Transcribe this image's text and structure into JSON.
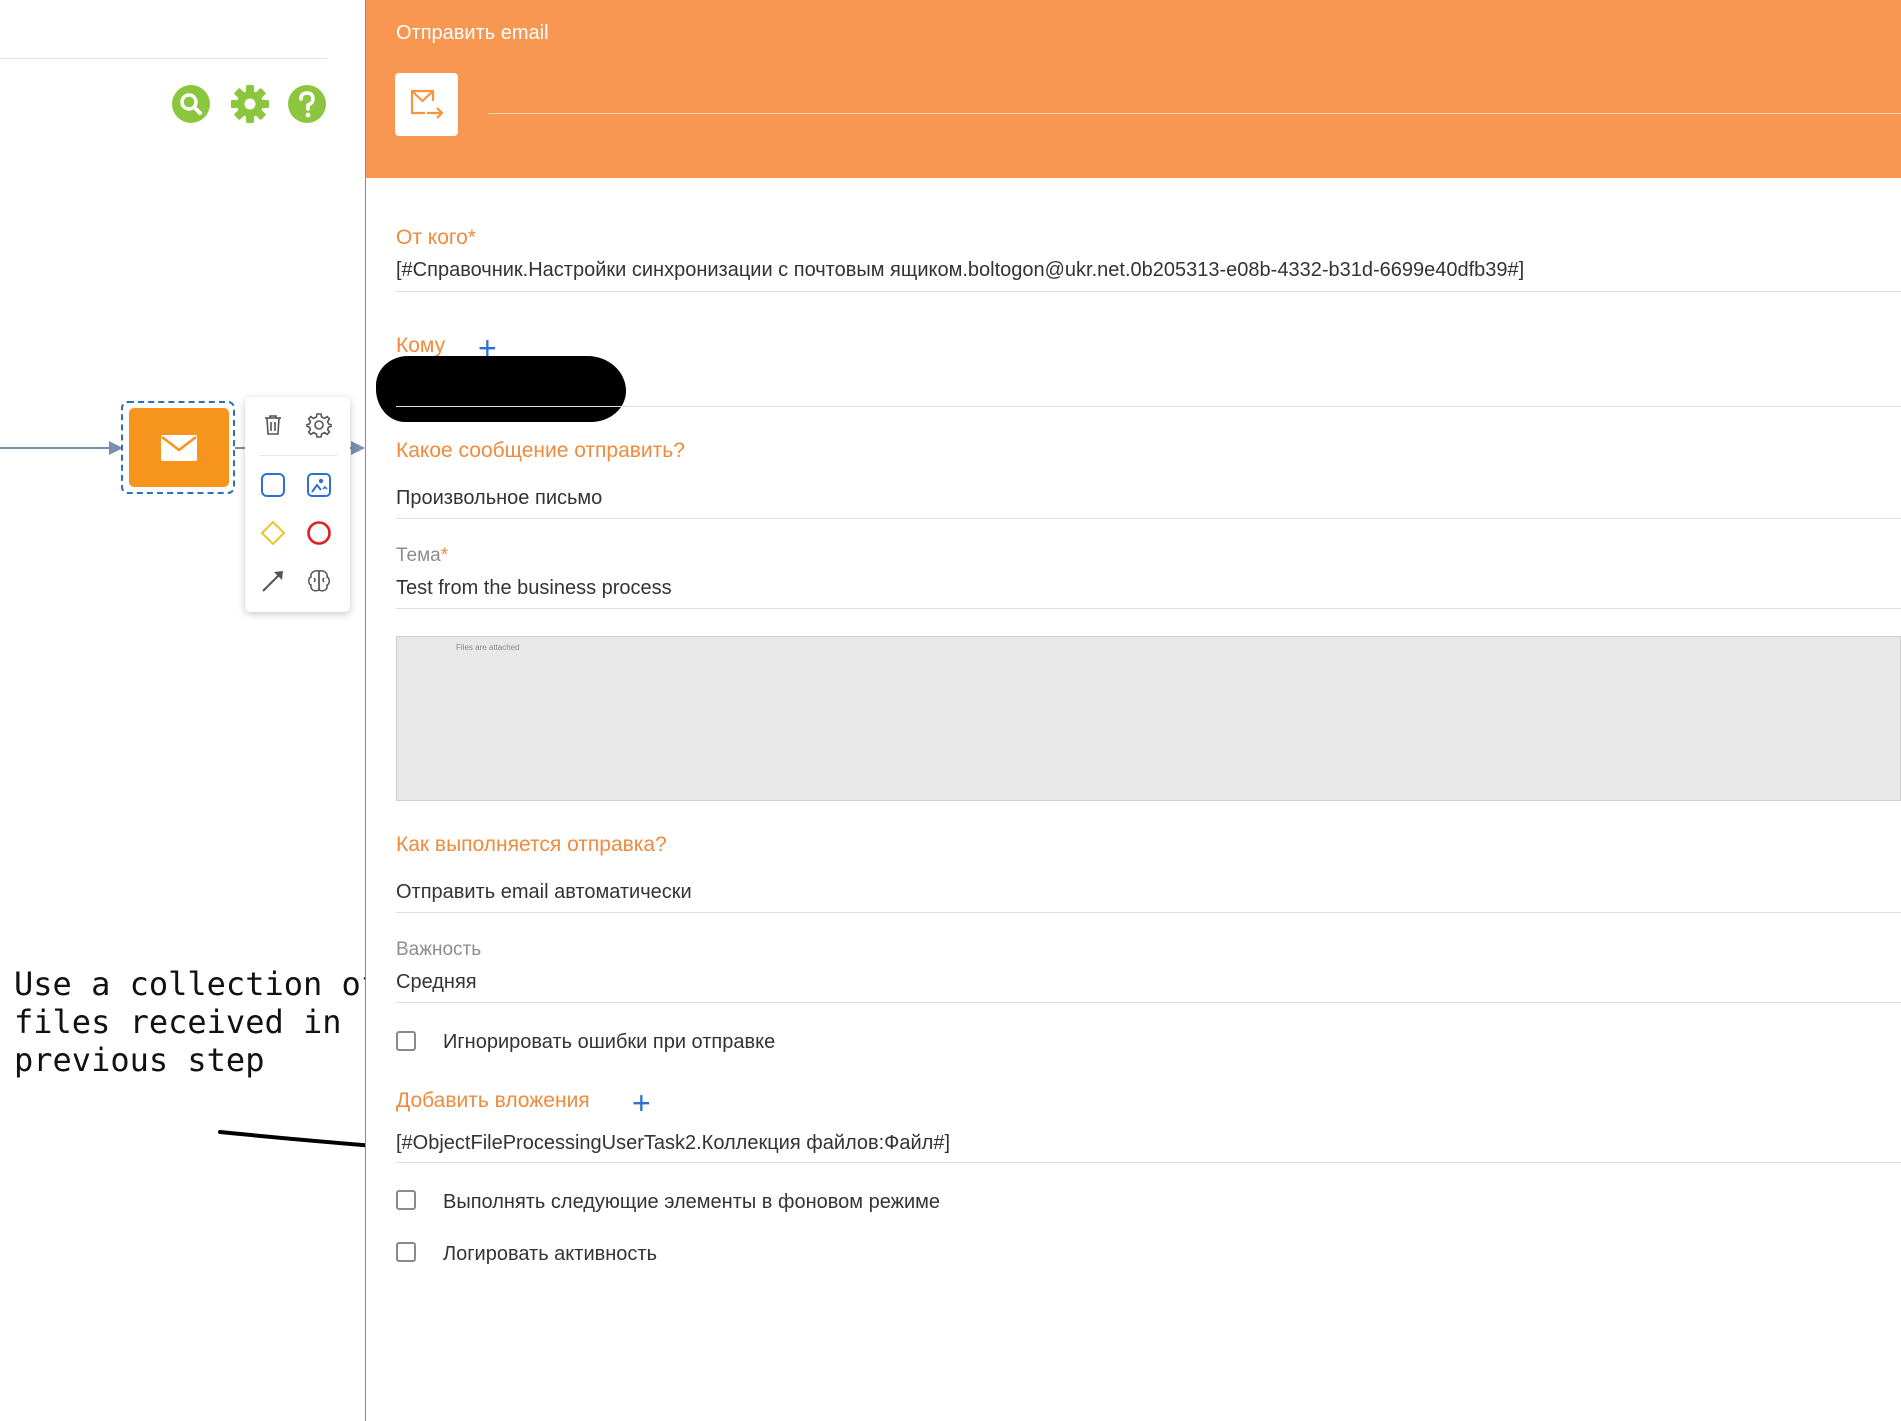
{
  "canvas": {
    "toolbar_icons": [
      "search-icon",
      "gear-icon",
      "help-icon"
    ],
    "toolbar_color": "#8cc63f",
    "node": {
      "icon": "mail-icon",
      "color": "#f7941d"
    },
    "node_menu": {
      "items": [
        "trash-icon",
        "settings-icon",
        "task-shape-icon",
        "ai-image-icon",
        "gateway-icon",
        "end-event-icon",
        "connector-arrow-icon",
        "brain-icon"
      ]
    },
    "annotation": "Use a collection of\nfiles received in\nprevious step"
  },
  "panel": {
    "title": "Отправить email",
    "header_color": "#f79752",
    "accent_color": "#f08a3c",
    "fields": {
      "from_label": "От кого",
      "from_value": "[#Справочник.Настройки синхронизации с почтовым ящиком.boltogon@ukr.net.0b205313-e08b-4332-b31d-6699e40dfb39#]",
      "to_label": "Кому",
      "message_label": "Какое сообщение отправить?",
      "message_value": "Произвольное письмо",
      "subject_label": "Тема",
      "subject_value": "Test from the business process",
      "body_preview_text": "Files are attached",
      "send_mode_label": "Как выполняется отправка?",
      "send_mode_value": "Отправить email автоматически",
      "importance_label": "Важность",
      "importance_value": "Средняя",
      "ignore_errors_label": "Игнорировать ошибки при отправке",
      "attachments_label": "Добавить вложения",
      "attachments_value": "[#ObjectFileProcessingUserTask2.Коллекция файлов:Файл#]",
      "background_label": "Выполнять следующие элементы в фоновом режиме",
      "log_label": "Логировать активность"
    },
    "required_marker": "*",
    "add_symbol": "+"
  }
}
